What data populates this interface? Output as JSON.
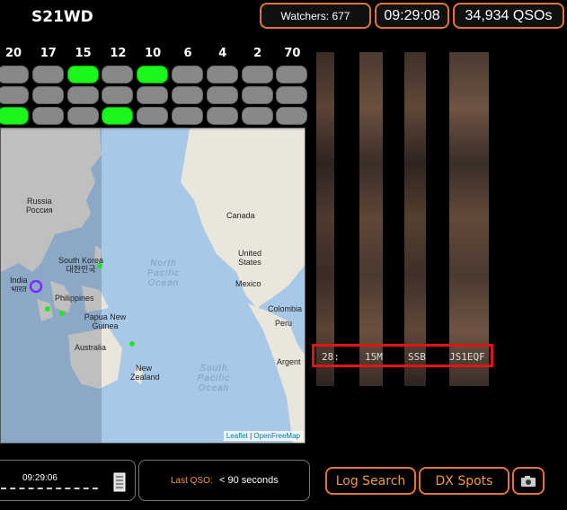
{
  "header": {
    "callsign": "S21WD",
    "watchers_label": "Watchers:",
    "watchers_value": "677",
    "clock": "09:29:08",
    "qso_count": "34,934",
    "qso_unit": "QSOs"
  },
  "bands": {
    "labels": [
      "20",
      "17",
      "15",
      "12",
      "10",
      "6",
      "4",
      "2",
      "70"
    ],
    "rows": [
      [
        false,
        false,
        true,
        false,
        true,
        false,
        false,
        false,
        false
      ],
      [
        false,
        false,
        false,
        false,
        false,
        false,
        false,
        false,
        false
      ],
      [
        true,
        false,
        false,
        true,
        false,
        false,
        false,
        false,
        false
      ]
    ]
  },
  "map": {
    "labels": {
      "russia": "Russia",
      "russia_native": "Россия",
      "canada": "Canada",
      "south_korea": "South Korea",
      "south_korea_native": "대한민국",
      "united_states": "United States",
      "india": "India",
      "india_native": "भारत",
      "philippines": "Philippines",
      "mexico": "Mexico",
      "png": "Papua New Guinea",
      "colombia": "Colombia",
      "peru": "Peru",
      "australia": "Australia",
      "new_zealand": "New Zealand",
      "argentina": "Argent",
      "north_pacific": "North Pacific Ocean",
      "south_pacific": "South Pacific Ocean"
    },
    "attribution_leaflet": "Leaflet",
    "attribution_sep": " | ",
    "attribution_osm": "OpenFreeMap"
  },
  "log_line": {
    "time": "28:",
    "band": "15M",
    "mode": "SSB",
    "call": "JS1EQF"
  },
  "bottom": {
    "time": "09:29:06",
    "last_qso_label": "Last QSO:",
    "last_qso_value": "< 90 seconds",
    "log_search": "Log Search",
    "dx_spots": "DX Spots"
  },
  "icons": {
    "camera": "camera-icon",
    "document": "document-icon"
  },
  "colors": {
    "accent": "#e5743a",
    "band_active": "#1bf71b",
    "band_idle": "#888888",
    "highlight": "#e21414"
  }
}
